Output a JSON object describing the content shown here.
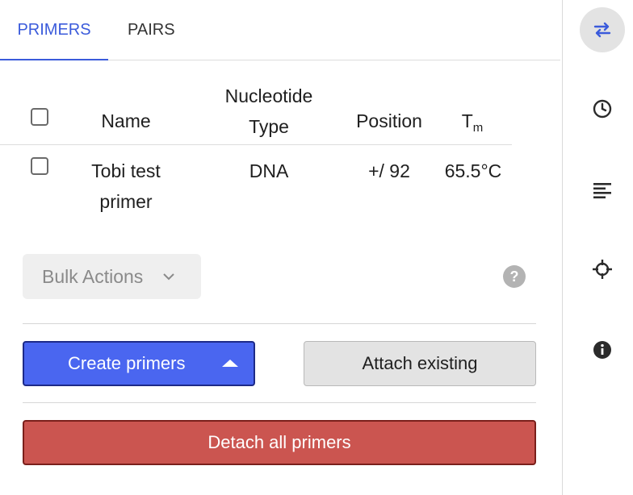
{
  "tabs": [
    {
      "label": "PRIMERS",
      "active": true
    },
    {
      "label": "PAIRS",
      "active": false
    }
  ],
  "table": {
    "headers": {
      "name": "Name",
      "nucleotide_type": "Nucleotide Type",
      "position": "Position",
      "tm_main": "T",
      "tm_sub": "m"
    },
    "rows": [
      {
        "name": "Tobi test primer",
        "type": "DNA",
        "position": "+/ 92",
        "tm": "65.5°C"
      }
    ]
  },
  "bulk_actions": {
    "label": "Bulk Actions"
  },
  "help": {
    "label": "?"
  },
  "buttons": {
    "create": "Create primers",
    "attach": "Attach existing",
    "detach": "Detach all primers"
  },
  "rail": {
    "items": [
      {
        "icon": "swap-arrows-icon",
        "active": true
      },
      {
        "icon": "clock-icon",
        "active": false
      },
      {
        "icon": "align-left-icon",
        "active": false
      },
      {
        "icon": "crosshair-icon",
        "active": false
      },
      {
        "icon": "info-icon",
        "active": false
      }
    ]
  },
  "colors": {
    "accent": "#3b5bdb",
    "primary_button": "#4a66f0",
    "danger_button": "#cb5550"
  }
}
